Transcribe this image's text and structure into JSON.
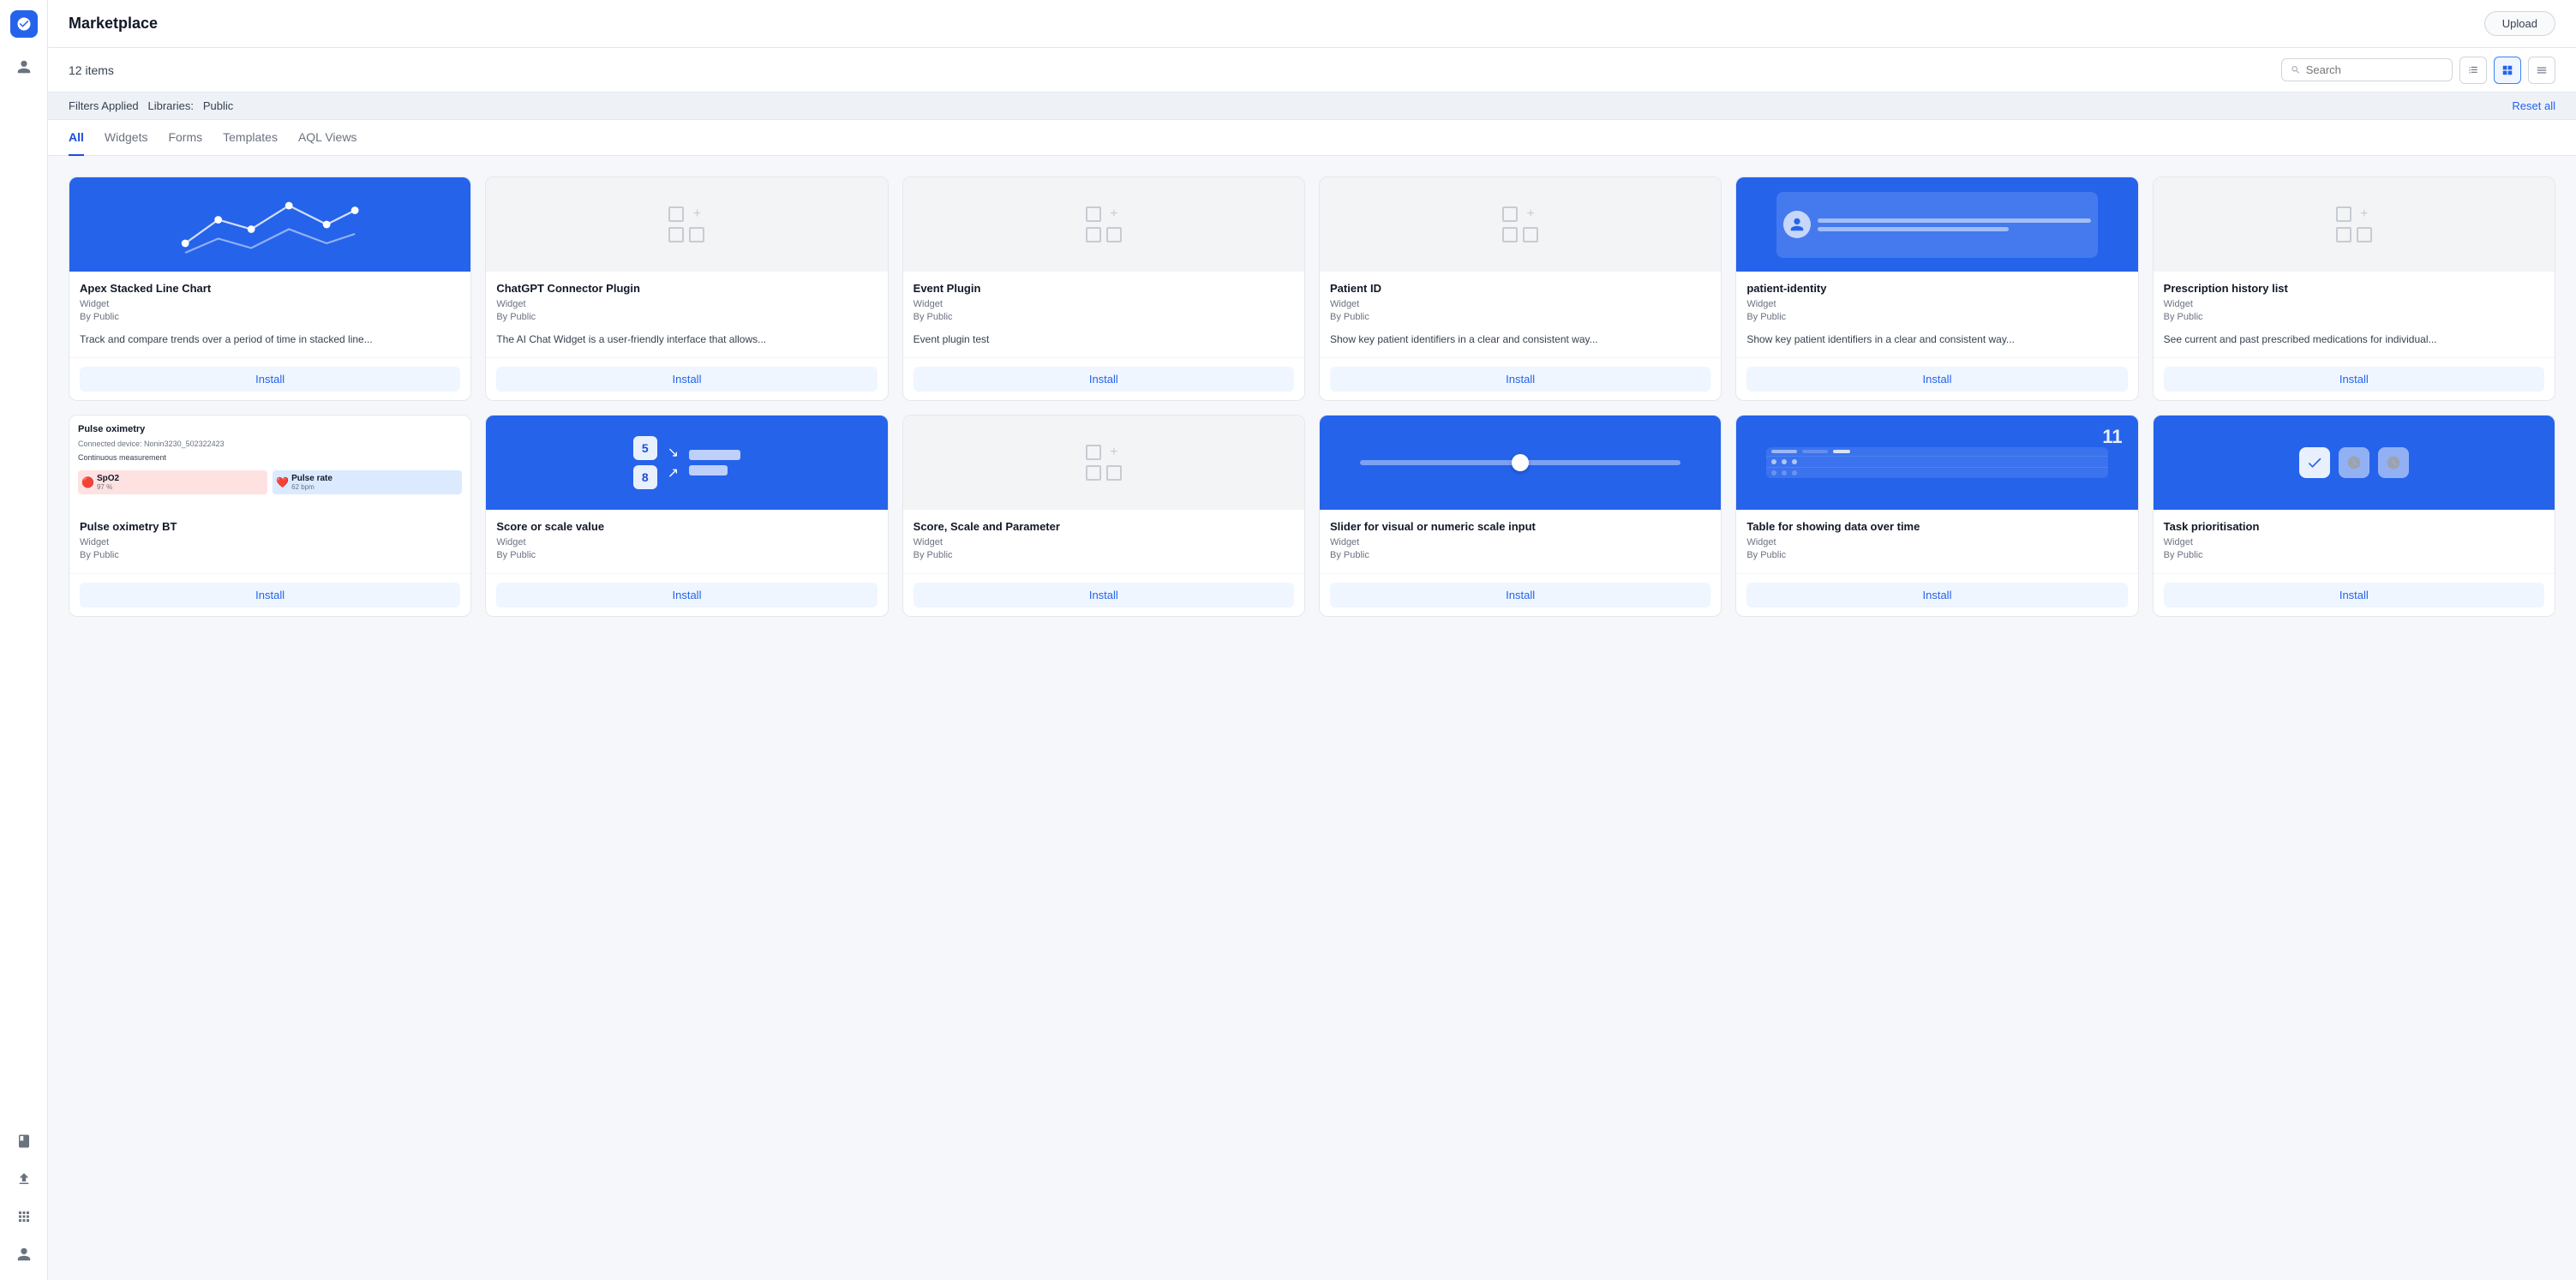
{
  "app": {
    "logo": "⚙",
    "title": "Marketplace",
    "upload_label": "Upload"
  },
  "toolbar": {
    "items_count": "12 items",
    "search_placeholder": "Search",
    "view_list_icon": "≡",
    "view_grid_icon": "⊞",
    "view_menu_icon": "☰"
  },
  "filter_bar": {
    "label": "Filters Applied",
    "libraries_label": "Libraries:",
    "filter_value": "Public",
    "reset_label": "Reset all"
  },
  "tabs": [
    {
      "id": "all",
      "label": "All",
      "active": true
    },
    {
      "id": "widgets",
      "label": "Widgets",
      "active": false
    },
    {
      "id": "forms",
      "label": "Forms",
      "active": false
    },
    {
      "id": "templates",
      "label": "Templates",
      "active": false
    },
    {
      "id": "aql-views",
      "label": "AQL Views",
      "active": false
    }
  ],
  "cards": [
    {
      "id": "apex-stacked-line",
      "title": "Apex Stacked Line Chart",
      "type": "Widget",
      "author": "By Public",
      "description": "Track and compare trends over a period of time in stacked line...",
      "thumbnail_type": "chart",
      "install_label": "Install"
    },
    {
      "id": "chatgpt-connector",
      "title": "ChatGPT Connector Plugin",
      "type": "Widget",
      "author": "By Public",
      "description": "The AI Chat Widget is a user-friendly interface that allows...",
      "thumbnail_type": "grid-icon",
      "install_label": "Install"
    },
    {
      "id": "event-plugin",
      "title": "Event Plugin",
      "type": "Widget",
      "author": "By Public",
      "description": "Event plugin test",
      "thumbnail_type": "grid-icon",
      "install_label": "Install"
    },
    {
      "id": "patient-id",
      "title": "Patient ID",
      "type": "Widget",
      "author": "By Public",
      "description": "Show key patient identifiers in a clear and consistent way...",
      "thumbnail_type": "grid-icon",
      "install_label": "Install"
    },
    {
      "id": "patient-identity",
      "title": "patient-identity",
      "type": "Widget",
      "author": "By Public",
      "description": "Show key patient identifiers in a clear and consistent way...",
      "thumbnail_type": "patient-identity",
      "install_label": "Install"
    },
    {
      "id": "prescription-history",
      "title": "Prescription history list",
      "type": "Widget",
      "author": "By Public",
      "description": "See current and past prescribed medications for individual...",
      "thumbnail_type": "grid-icon",
      "install_label": "Install"
    },
    {
      "id": "pulse-oximetry",
      "title": "Pulse oximetry BT",
      "type": "Widget",
      "author": "By Public",
      "description": "",
      "thumbnail_type": "pulse",
      "install_label": "Install"
    },
    {
      "id": "score-scale",
      "title": "Score or scale value",
      "type": "Widget",
      "author": "By Public",
      "description": "",
      "thumbnail_type": "score",
      "install_label": "Install"
    },
    {
      "id": "score-scale-param",
      "title": "Score, Scale and Parameter",
      "type": "Widget",
      "author": "By Public",
      "description": "",
      "thumbnail_type": "grid-icon",
      "install_label": "Install"
    },
    {
      "id": "slider-visual",
      "title": "Slider for visual or numeric scale input",
      "type": "Widget",
      "author": "By Public",
      "description": "",
      "thumbnail_type": "slider",
      "install_label": "Install"
    },
    {
      "id": "table-showing",
      "title": "Table for showing data over time",
      "type": "Widget",
      "author": "By Public",
      "description": "",
      "thumbnail_type": "table",
      "install_label": "Install"
    },
    {
      "id": "task-prioritisation",
      "title": "Task prioritisation",
      "type": "Widget",
      "author": "By Public",
      "description": "",
      "thumbnail_type": "task",
      "install_label": "Install"
    }
  ],
  "sidebar": {
    "items": [
      {
        "id": "user",
        "icon": "👤"
      },
      {
        "id": "book",
        "icon": "📖"
      },
      {
        "id": "upload",
        "icon": "⬆"
      },
      {
        "id": "grid",
        "icon": "⊞"
      },
      {
        "id": "person",
        "icon": "👤"
      }
    ]
  }
}
